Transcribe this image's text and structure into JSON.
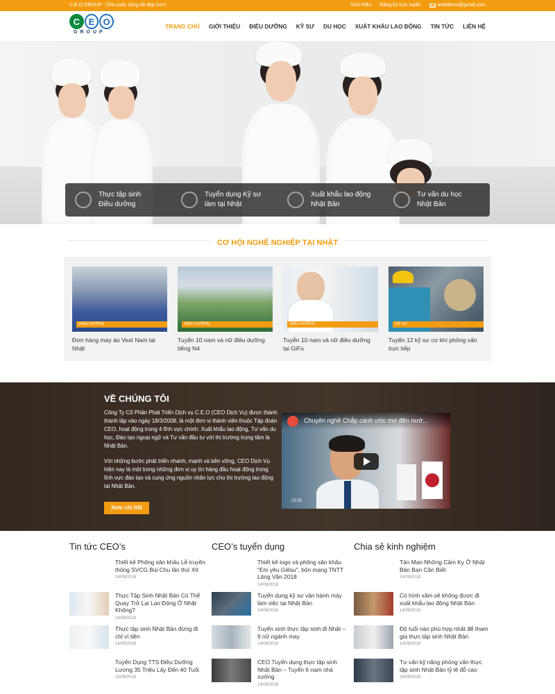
{
  "topbar": {
    "tagline": "C.E.O GROUP - Cho cuộc sống tốt đẹp hơn!",
    "links": [
      "Giới thiệu",
      "Đăng ký trực tuyến"
    ],
    "email": "webdemo@gmail.com"
  },
  "logo": {
    "letters": [
      "C",
      "E",
      "O"
    ],
    "group": "GROUP"
  },
  "nav": [
    "TRANG CHỦ",
    "GIỚI THIỆU",
    "ĐIỀU DƯỠNG",
    "KỸ SƯ",
    "DU HỌC",
    "XUẤT KHẨU LAO ĐỘNG",
    "TIN TỨC",
    "LIÊN HỆ"
  ],
  "features": [
    {
      "l1": "Thực tập sinh",
      "l2": "Điều dưỡng",
      "icon": "globe-icon"
    },
    {
      "l1": "Tuyển dụng Kỹ sư",
      "l2": "làm tại Nhật",
      "icon": "tools-icon"
    },
    {
      "l1": "Xuất khẩu lao động",
      "l2": "Nhật Bản",
      "icon": "plane-icon"
    },
    {
      "l1": "Tư vấn du học",
      "l2": "Nhật Bản",
      "icon": "search-icon"
    }
  ],
  "section_title": "CƠ HỘI NGHỀ NGHIỆP TẠI NHẬT",
  "cards": [
    {
      "category": "ĐIỀU DƯỠNG",
      "title": "Đơn hàng may áo Vest Nam tại Nhật"
    },
    {
      "category": "ĐIỀU DƯỠNG",
      "title": "Tuyển 10 nam và nữ điều dưỡng tiếng N4"
    },
    {
      "category": "ĐIỀU DƯỠNG",
      "title": "Tuyển 10 nam và nữ điều dưỡng tại GiFu"
    },
    {
      "category": "KỸ SƯ",
      "title": "Tuyển 12 kỹ sư cơ khí phỏng vấn trực tiếp"
    }
  ],
  "about": {
    "title": "VỀ CHÚNG TÔI",
    "p1": "Công Ty Cổ Phần Phát Triển Dịch vụ C.E.O (CEO Dịch Vụ) được thành thành lập vào ngày 18/3/2008, là một đơn vị thành viên thuộc Tập đoàn CEO, hoạt động trong 4 lĩnh vực chính: Xuất khẩu lao động, Tư vấn du học, Đào tạo ngoại ngữ và Tư vấn đầu tư với thị trường trọng tâm là Nhật Bản.",
    "p2": "Với những bước phát triển nhanh, mạnh và bền vững, CEO Dịch Vụ hiện nay là một trong những đơn vị uy tín hàng đầu hoạt động trong lĩnh vực đào tạo và cung ứng nguồn nhân lực cho thị trường lao động tại Nhật Bản.",
    "button": "Xem chi tiết",
    "video_title": "Chuyên nghề Chắp cánh ước mơ đến nướ...",
    "video_time": "15:15"
  },
  "columns": [
    {
      "title": "Tin tức CEO’s",
      "items": [
        {
          "title": "Thiết kế Phông sân khấu Lễ truyền thống SVCG Bùi Chu lần thứ XII",
          "date": "14/09/2018",
          "pic": "none"
        },
        {
          "title": "Thực Tập Sinh Nhật Bản Có Thể Quay Trở Lại Lao Động Ở Nhật Không?",
          "date": "14/09/2018",
          "pic": "nurses"
        },
        {
          "title": "Thực tập sinh Nhật Bản đừng đi chỉ vì tiền",
          "date": "14/09/2018",
          "pic": "nurses2"
        },
        {
          "title": "Tuyển Dụng TTS Điều Dưỡng Lương 35 Triệu Lấy Đến 40 Tuổi",
          "date": "14/09/2018",
          "pic": "none"
        }
      ]
    },
    {
      "title": "CEO’s tuyển dụng",
      "items": [
        {
          "title": "Thiết kế logo và phông sân khấu \"Em yêu Giêsu\", bốn mạng TNTT Lãng Văn 2018",
          "date": "14/09/2018",
          "pic": "none"
        },
        {
          "title": "Tuyển dụng kỹ sư vận hành máy làm việc tại Nhật Bản",
          "date": "14/09/2018",
          "pic": "factory"
        },
        {
          "title": "Tuyển sinh thực tập sinh đi Nhật – 9 nữ ngành may",
          "date": "14/09/2018",
          "pic": "sewing"
        },
        {
          "title": "CEO Tuyển dụng thực tập sinh Nhật Bản – Tuyển 6 nam nhà xưởng",
          "date": "14/09/2018",
          "pic": "workers"
        }
      ]
    },
    {
      "title": "Chia sẻ kinh nghiệm",
      "items": [
        {
          "title": "Tản Mạn Những Cấm Kỵ Ở Nhật Bản Bạn Cần Biết",
          "date": "14/09/2018",
          "pic": "none"
        },
        {
          "title": "Có hình xăm sẽ không được đi xuất khẩu lao động Nhật Bản",
          "date": "14/09/2018",
          "pic": "tattoo"
        },
        {
          "title": "Độ tuổi nào phù hợp nhất để tham gia thực tập sinh Nhật Bản",
          "date": "14/09/2018",
          "pic": "class"
        },
        {
          "title": "Tư vấn kỹ năng phỏng vấn thực tập sinh Nhật Bản tỷ lệ đỗ cao",
          "date": "14/09/2018",
          "pic": "interview"
        }
      ]
    }
  ]
}
